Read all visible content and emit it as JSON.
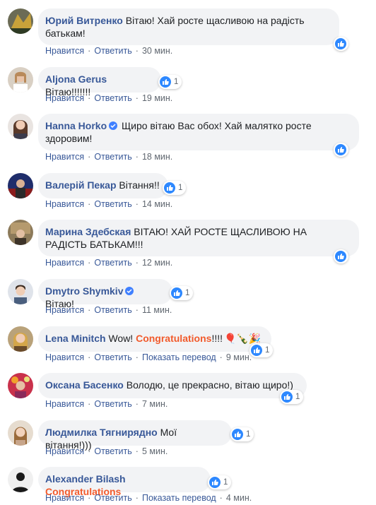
{
  "actions": {
    "like": "Нравится",
    "reply": "Ответить",
    "translate": "Показать перевод",
    "separator": "·"
  },
  "comments": [
    {
      "author": "Юрий Витренко",
      "text": "Вітаю! Хай росте щасливою на радість",
      "text2": "батькам!",
      "time": "30 мин.",
      "reactions": ""
    },
    {
      "author": "Aljona Gerus",
      "text": "Вітаю!!!!!!!",
      "time": "19 мин.",
      "reactions": "1"
    },
    {
      "author": "Hanna Horko",
      "text": "Щиро вітаю Вас обох! Хай малятко росте",
      "text2": "здоровим!",
      "time": "18 мин.",
      "reactions": ""
    },
    {
      "author": "Валерій Пекар",
      "text": "Вітання!!",
      "time": "14 мин.",
      "reactions": "1"
    },
    {
      "author": "Марина Здебская",
      "text": "ВІТАЮ! ХАЙ РОСТЕ ЩАСЛИВОЮ НА",
      "text2": "РАДІСТЬ БАТЬКАМ!!!",
      "time": "12 мин.",
      "reactions": ""
    },
    {
      "author": "Dmytro Shymkiv",
      "text": "Вітаю!",
      "time": "11 мин.",
      "reactions": "1"
    },
    {
      "author": "Lena Minitch",
      "text": "Wow!",
      "highlight": "Congratulations",
      "tail": "!!!!",
      "emojis": "🎈🍾🎉",
      "time": "9 мин.",
      "reactions": "1"
    },
    {
      "author": "Оксана Басенко",
      "text": "Володю, це прекрасно, вітаю щиро!)",
      "time": "7 мин.",
      "reactions": "1"
    },
    {
      "author": "Людмилка Тягнирядно",
      "text": "Мої вітання!)))",
      "time": "5 мин.",
      "reactions": "1"
    },
    {
      "author": "Alexander Bilash",
      "highlight": "Congratulations",
      "time": "4 мин.",
      "reactions": "1"
    }
  ],
  "colors": {
    "link": "#385898",
    "bubble": "#f2f3f5",
    "like": "#2d88ff",
    "congrats": "#f25a2b"
  }
}
